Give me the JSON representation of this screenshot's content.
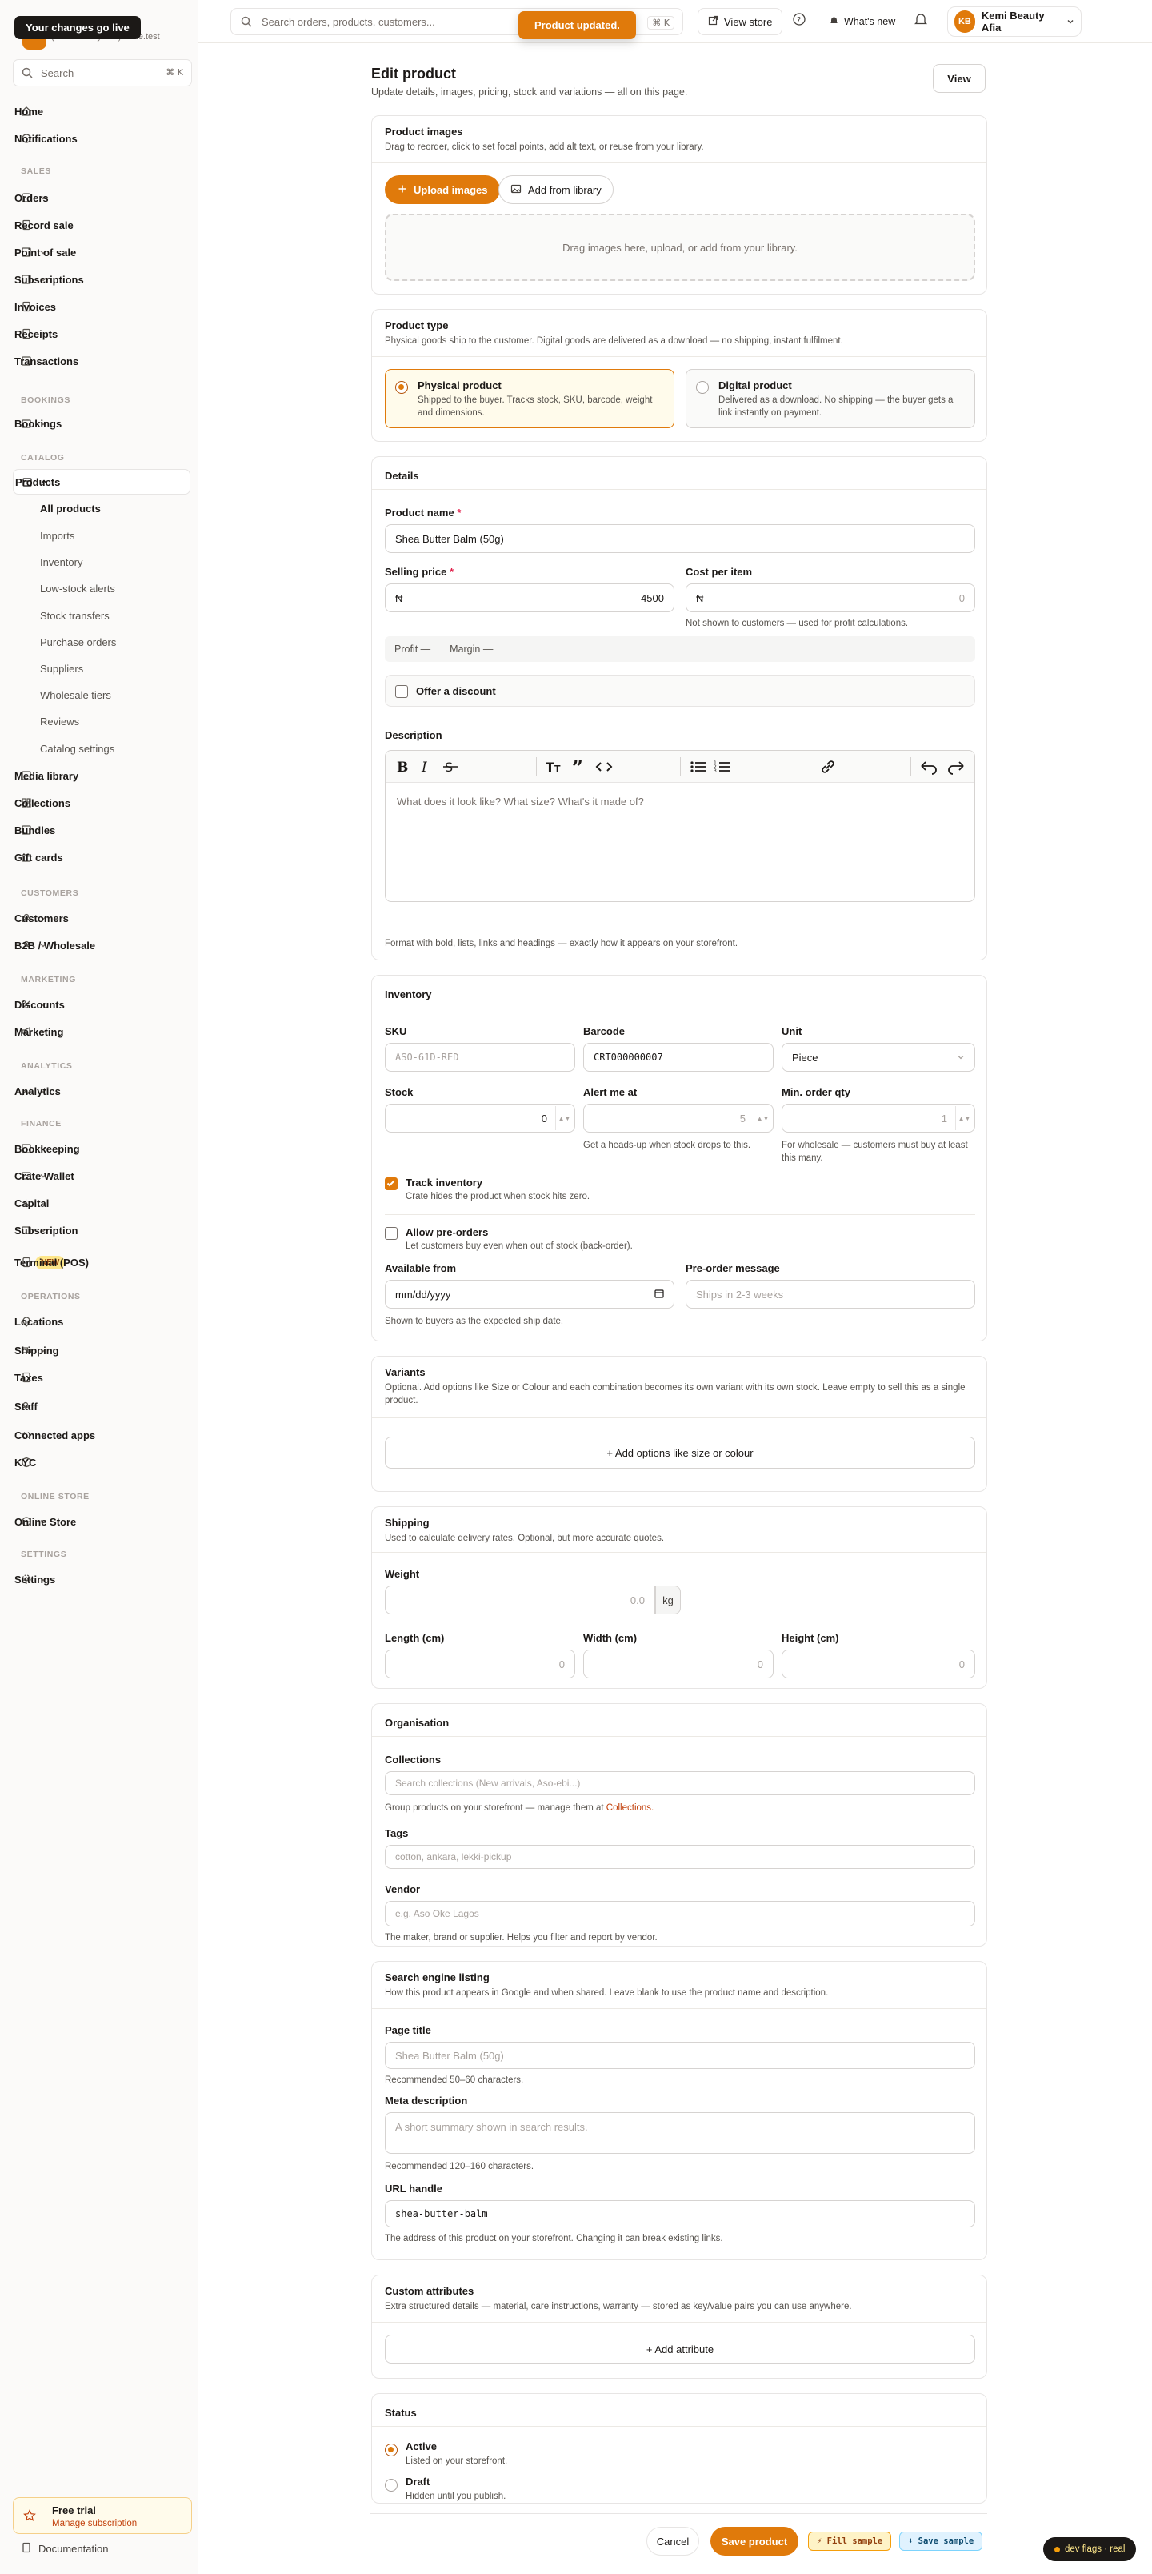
{
  "brand": {
    "live_pill": "Your changes go live",
    "subdomain": "(kemi beauty afia).crate.test",
    "initials": "KB"
  },
  "sidebar": {
    "search_placeholder": "Search",
    "search_shortcut": "⌘ K",
    "home": "Home",
    "notifications": "Notifications",
    "sec_sales": "SALES",
    "orders": "Orders",
    "record_sale": "Record sale",
    "pos": "Point of sale",
    "subscriptions": "Subscriptions",
    "invoices": "Invoices",
    "receipts": "Receipts",
    "transactions": "Transactions",
    "sec_bookings": "BOOKINGS",
    "bookings": "Bookings",
    "sec_catalog": "CATALOG",
    "products": "Products",
    "sub_items": [
      "All products",
      "Imports",
      "Inventory",
      "Low-stock alerts",
      "Stock transfers",
      "Purchase orders",
      "Suppliers",
      "Wholesale tiers",
      "Reviews",
      "Catalog settings"
    ],
    "media": "Media library",
    "collections": "Collections",
    "bundles": "Bundles",
    "gift_cards": "Gift cards",
    "sec_customers": "CUSTOMERS",
    "customers": "Customers",
    "b2b": "B2B / Wholesale",
    "sec_marketing": "MARKETING",
    "discounts": "Discounts",
    "marketing": "Marketing",
    "sec_analytics": "ANALYTICS",
    "analytics": "Analytics",
    "sec_finance": "FINANCE",
    "bookkeeping": "Bookkeeping",
    "wallet": "Crate Wallet",
    "capital": "Capital",
    "subscription": "Subscription",
    "terminal": "Terminal (POS)",
    "new_badge": "NEW",
    "sec_operations": "OPERATIONS",
    "locations": "Locations",
    "shipping": "Shipping",
    "taxes": "Taxes",
    "staff": "Staff",
    "connected_apps": "Connected apps",
    "kyc": "KYC",
    "sec_online": "ONLINE STORE",
    "online_store": "Online Store",
    "sec_settings": "SETTINGS",
    "settings": "Settings",
    "trial_title": "Free trial",
    "trial_link": "Manage subscription",
    "documentation": "Documentation"
  },
  "topbar": {
    "search_placeholder": "Search orders, products, customers...",
    "search_shortcut": "⌘ K",
    "toast": "Product updated.",
    "view_store": "View store",
    "whats_new": "What's new",
    "account": "Kemi Beauty Afia"
  },
  "page": {
    "title": "Edit product",
    "subtitle": "Update details, images, pricing, stock and variations — all on this page.",
    "view": "View"
  },
  "images": {
    "title": "Product images",
    "sub": "Drag to reorder, click to set focal points, add alt text, or reuse from your library.",
    "upload": "Upload images",
    "library": "Add from library",
    "drop": "Drag images here, upload, or add from your library."
  },
  "ptype": {
    "title": "Product type",
    "sub": "Physical goods ship to the customer. Digital goods are delivered as a download — no shipping, instant fulfilment.",
    "phys_t": "Physical product",
    "phys_d": "Shipped to the buyer. Tracks stock, SKU, barcode, weight and dimensions.",
    "dig_t": "Digital product",
    "dig_d": "Delivered as a download. No shipping — the buyer gets a link instantly on payment."
  },
  "details": {
    "title": "Details",
    "name_label": "Product name",
    "name_value": "Shea Butter Balm (50g)",
    "price_label": "Selling price",
    "currency": "₦",
    "price_value": "4500",
    "cost_label": "Cost per item",
    "cost_placeholder": "0",
    "cost_help": "Not shown to customers — used for profit calculations.",
    "profit": "Profit —",
    "margin": "Margin —",
    "discount": "Offer a discount",
    "desc_label": "Description",
    "desc_placeholder": "What does it look like? What size? What's it made of?",
    "desc_help": "Format with bold, lists, links and headings — exactly how it appears on your storefront."
  },
  "inventory": {
    "title": "Inventory",
    "sku_label": "SKU",
    "sku_placeholder": "ASO-61D-RED",
    "barcode_label": "Barcode",
    "barcode_value": "CRT000000007",
    "unit_label": "Unit",
    "unit_value": "Piece",
    "stock_label": "Stock",
    "stock_value": "0",
    "alert_label": "Alert me at",
    "alert_placeholder": "5",
    "alert_help": "Get a heads-up when stock drops to this.",
    "minqty_label": "Min. order qty",
    "minqty_placeholder": "1",
    "minqty_help": "For wholesale — customers must buy at least this many.",
    "track_t": "Track inventory",
    "track_d": "Crate hides the product when stock hits zero.",
    "pre_t": "Allow pre-orders",
    "pre_d": "Let customers buy even when out of stock (back-order).",
    "avail_label": "Available from",
    "avail_placeholder": "mm/dd/yyyy",
    "avail_help": "Shown to buyers as the expected ship date.",
    "premsg_label": "Pre-order message",
    "premsg_placeholder": "Ships in 2-3 weeks"
  },
  "variants": {
    "title": "Variants",
    "sub": "Optional. Add options like Size or Colour and each combination becomes its own variant with its own stock. Leave empty to sell this as a single product.",
    "add": "+ Add options like size or colour"
  },
  "shipping": {
    "title": "Shipping",
    "sub": "Used to calculate delivery rates. Optional, but more accurate quotes.",
    "weight_label": "Weight",
    "weight_placeholder": "0.0",
    "weight_unit": "kg",
    "length_label": "Length (cm)",
    "width_label": "Width (cm)",
    "height_label": "Height (cm)",
    "dim_placeholder": "0"
  },
  "org": {
    "title": "Organisation",
    "coll_label": "Collections",
    "coll_placeholder": "Search collections (New arrivals, Aso-ebi...)",
    "coll_help": "Group products on your storefront — manage them at",
    "coll_link": "Collections.",
    "tags_label": "Tags",
    "tags_placeholder": "cotton, ankara, lekki-pickup",
    "vendor_label": "Vendor",
    "vendor_placeholder": "e.g. Aso Oke Lagos",
    "vendor_help": "The maker, brand or supplier. Helps you filter and report by vendor."
  },
  "seo": {
    "title": "Search engine listing",
    "sub": "How this product appears in Google and when shared. Leave blank to use the product name and description.",
    "pt_label": "Page title",
    "pt_placeholder": "Shea Butter Balm (50g)",
    "pt_help": "Recommended 50–60 characters.",
    "md_label": "Meta description",
    "md_placeholder": "A short summary shown in search results.",
    "md_help": "Recommended 120–160 characters.",
    "url_label": "URL handle",
    "url_value": "shea-butter-balm",
    "url_help": "The address of this product on your storefront. Changing it can break existing links."
  },
  "attrs": {
    "title": "Custom attributes",
    "sub": "Extra structured details — material, care instructions, warranty — stored as key/value pairs you can use anywhere.",
    "add": "+ Add attribute"
  },
  "status": {
    "title": "Status",
    "active_t": "Active",
    "active_d": "Listed on your storefront.",
    "draft_t": "Draft",
    "draft_d": "Hidden until you publish."
  },
  "footer": {
    "cancel": "Cancel",
    "save": "Save product",
    "fill": "⚡ Fill sample",
    "save_sample": "⬇ Save sample",
    "dev": "dev flags · real"
  },
  "colors": {
    "accent": "#e07a0b",
    "text": "#1c1917",
    "muted": "#57534e"
  }
}
